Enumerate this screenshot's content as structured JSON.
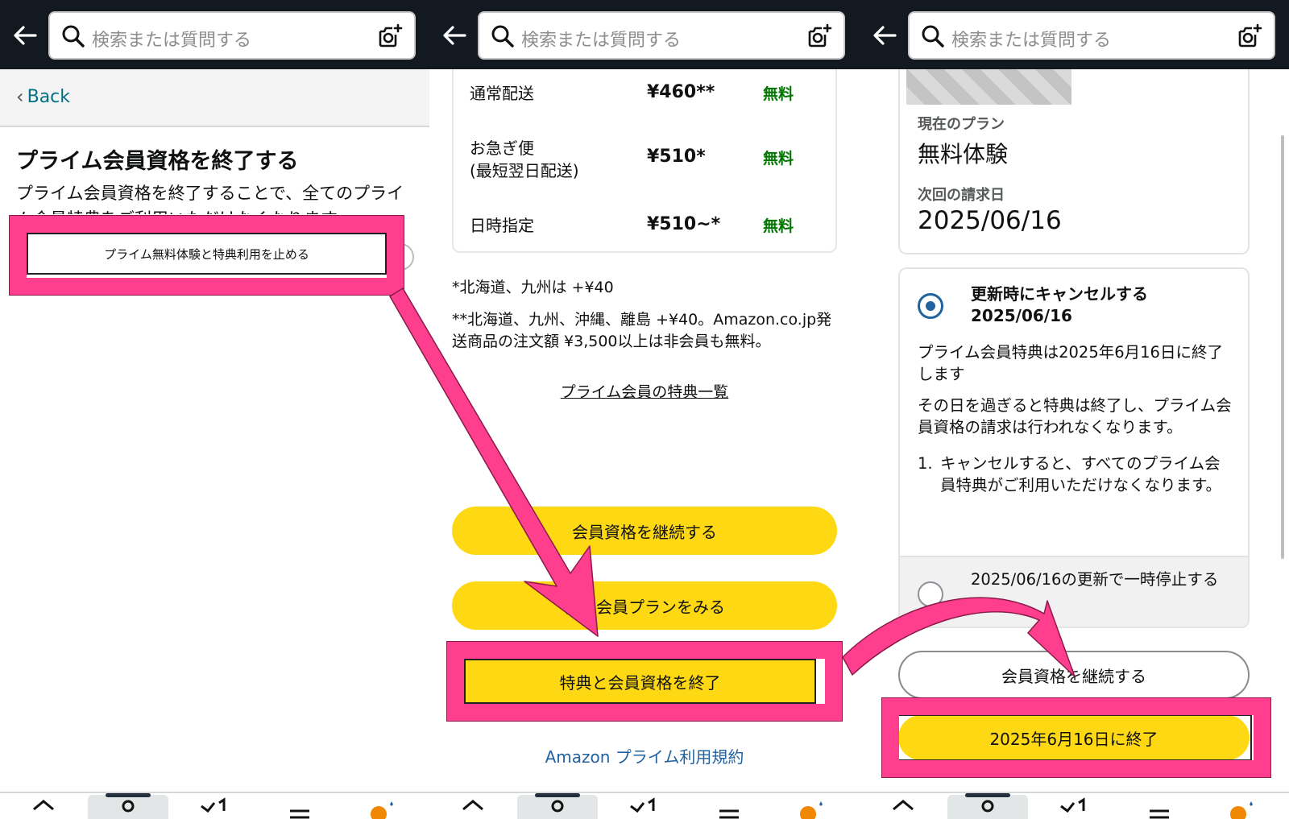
{
  "search": {
    "placeholder": "検索または質問する"
  },
  "icons": {
    "back": "arrow-left-icon",
    "search": "search-icon",
    "camera": "camera-plus-icon"
  },
  "colors": {
    "header_bg": "#131921",
    "primary_yellow": "#ffd814",
    "link_blue": "#2162a1",
    "free_green": "#007600",
    "highlight_pink": "#ff3f8e"
  },
  "panel1": {
    "back_label": "Back",
    "title": "プライム会員資格を終了する",
    "description": "プライム会員資格を終了することで、全てのプライム会員特典をご利用いただけなくなります。",
    "stop_button": "プライム無料体験と特典利用を止める"
  },
  "panel2": {
    "shipping": [
      {
        "name": "通常配送",
        "price": "¥460**",
        "free": "無料"
      },
      {
        "name": "お急ぎ便\n(最短翌日配送)",
        "price": "¥510*",
        "free": "無料"
      },
      {
        "name": "日時指定",
        "price": "¥510~*",
        "free": "無料"
      }
    ],
    "note1": "*北海道、九州は +¥40",
    "note2": "**北海道、九州、沖縄、離島 +¥40。Amazon.co.jp発送商品の注文額 ¥3,500以上は非会員も無料。",
    "benefits_link": "プライム会員の特典一覧",
    "continue_button": "会員資格を継続する",
    "plans_button": "他の会員プランをみる",
    "end_button": "特典と会員資格を終了",
    "terms_link": "Amazon プライム利用規約"
  },
  "panel3": {
    "current_plan_label": "現在のプラン",
    "current_plan_value": "無料体験",
    "next_billing_label": "次回の請求日",
    "next_billing_value": "2025/06/16",
    "option1_title": "更新時にキャンセルする\n2025/06/16",
    "option1_text1": "プライム会員特典は2025年6月16日に終了します",
    "option1_text2": "その日を過ぎると特典は終了し、プライム会員資格の請求は行われなくなります。",
    "option1_list_num": "1.",
    "option1_list_text": "キャンセルすると、すべてのプライム会員特典がご利用いただけなくなります。",
    "option2_text": "2025/06/16の更新で一時停止する",
    "continue_button": "会員資格を継続する",
    "end_button": "2025年6月16日に終了"
  },
  "nav": {
    "items": [
      "home-icon",
      "account-icon",
      "hub-icon",
      "menu-icon",
      "rufus-icon"
    ],
    "active": "account-icon"
  }
}
